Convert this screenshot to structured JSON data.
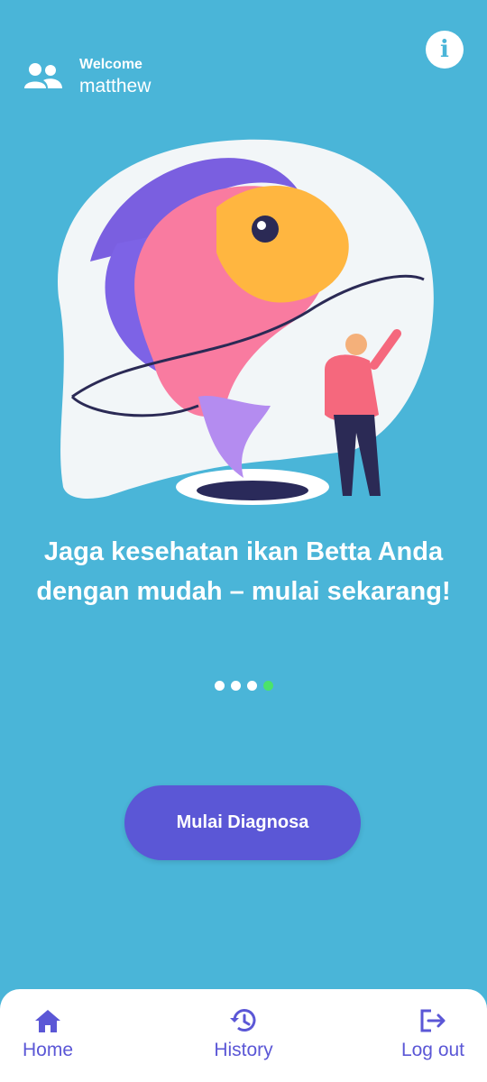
{
  "header": {
    "welcome_label": "Welcome",
    "username": "matthew",
    "info_icon": "info-icon",
    "user_icon": "users-icon"
  },
  "slide": {
    "title_line1": "Jaga kesehatan ikan Betta Anda",
    "title_line2": "dengan mudah – mulai sekarang!",
    "total": 4,
    "active": 4
  },
  "cta": {
    "label": "Mulai Diagnosa"
  },
  "nav": {
    "items": [
      {
        "label": "Home",
        "icon": "home-icon"
      },
      {
        "label": "History",
        "icon": "history-icon"
      },
      {
        "label": "Log out",
        "icon": "logout-icon"
      }
    ]
  },
  "colors": {
    "background": "#4ab5d8",
    "accent": "#5b57d6",
    "active_dot": "#4be36a"
  }
}
